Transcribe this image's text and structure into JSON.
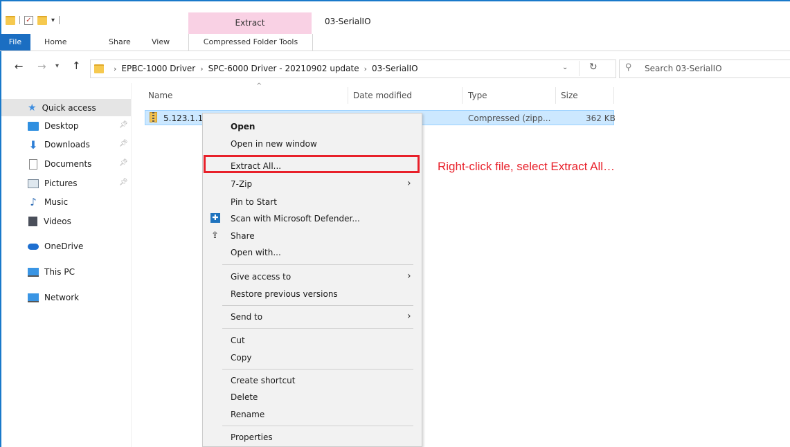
{
  "window": {
    "title": "03-SerialIO",
    "context_tab_group": "Extract"
  },
  "ribbon": {
    "tabs": [
      "File",
      "Home",
      "Share",
      "View",
      "Compressed Folder Tools"
    ]
  },
  "address": {
    "breadcrumb": [
      "EPBC-1000 Driver",
      "SPC-6000 Driver - 20210902 update",
      "03-SerialIO"
    ],
    "search_placeholder": "Search 03-SerialIO"
  },
  "nav_pane": {
    "items": [
      {
        "label": "Quick access",
        "icon": "star-icon"
      },
      {
        "label": "Desktop",
        "icon": "desktop-icon",
        "pinned": true
      },
      {
        "label": "Downloads",
        "icon": "download-icon",
        "pinned": true
      },
      {
        "label": "Documents",
        "icon": "documents-icon",
        "pinned": true
      },
      {
        "label": "Pictures",
        "icon": "pictures-icon",
        "pinned": true
      },
      {
        "label": "Music",
        "icon": "music-icon"
      },
      {
        "label": "Videos",
        "icon": "videos-icon"
      },
      {
        "label": "OneDrive",
        "icon": "cloud-icon"
      },
      {
        "label": "This PC",
        "icon": "pc-icon"
      },
      {
        "label": "Network",
        "icon": "network-icon"
      }
    ]
  },
  "file_list": {
    "columns": [
      "Name",
      "Date modified",
      "Type",
      "Size"
    ],
    "rows": [
      {
        "name": "5.123.1.10",
        "type": "Compressed (zipp...",
        "size": "362 KB"
      }
    ]
  },
  "context_menu": {
    "items": [
      {
        "label": "Open",
        "bold": true
      },
      {
        "label": "Open in new window"
      },
      {
        "label": "Extract All..."
      },
      {
        "label": "7-Zip",
        "submenu": true
      },
      {
        "label": "Pin to Start"
      },
      {
        "label": "Scan with Microsoft Defender..."
      },
      {
        "label": "Share"
      },
      {
        "label": "Open with..."
      },
      {
        "label": "Give access to",
        "submenu": true
      },
      {
        "label": "Restore previous versions"
      },
      {
        "label": "Send to",
        "submenu": true
      },
      {
        "label": "Cut"
      },
      {
        "label": "Copy"
      },
      {
        "label": "Create shortcut"
      },
      {
        "label": "Delete"
      },
      {
        "label": "Rename"
      },
      {
        "label": "Properties"
      }
    ]
  },
  "annotation": {
    "text": "Right-click file, select Extract All…",
    "color": "#e8202a"
  },
  "colors": {
    "accent": "#1b6ec2",
    "selection": "#cce8ff",
    "context_tab": "#f9d1e4"
  }
}
